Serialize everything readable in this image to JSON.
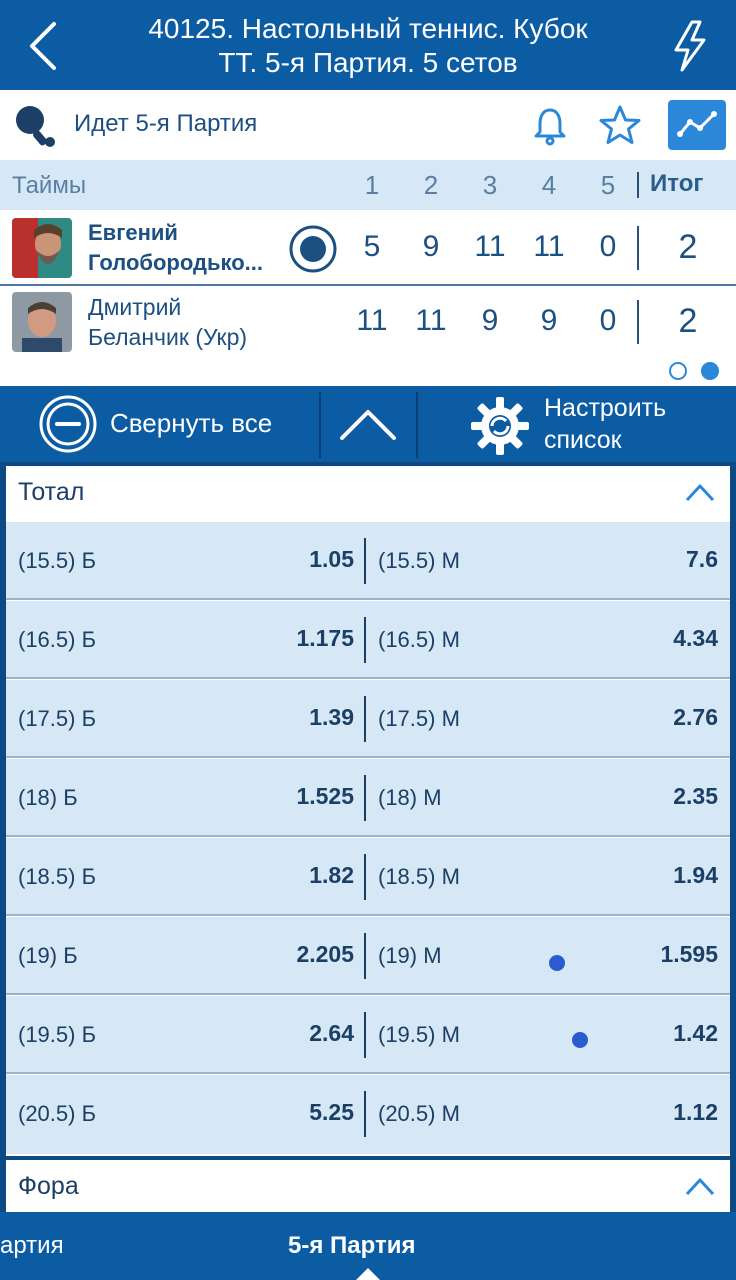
{
  "header": {
    "title": "40125. Настольный теннис. Кубок\nТТ. 5-я  Партия. 5 сетов"
  },
  "status": {
    "label": "Идет 5-я  Партия"
  },
  "scoreboard": {
    "header_label": "Таймы",
    "sets": [
      "1",
      "2",
      "3",
      "4",
      "5"
    ],
    "total_label": "Итог",
    "players": [
      {
        "name": "Евгений\nГолобородько...",
        "scores": [
          "5",
          "9",
          "11",
          "11",
          "0"
        ],
        "total": "2",
        "serving": true
      },
      {
        "name": "Дмитрий\nБеланчик (Укр)",
        "scores": [
          "11",
          "11",
          "9",
          "9",
          "0"
        ],
        "total": "2",
        "serving": false
      }
    ]
  },
  "toolbar": {
    "collapse_label": "Свернуть все",
    "configure_label": "Настроить\nсписок"
  },
  "markets": {
    "total": {
      "title": "Тотал",
      "rows": [
        {
          "over_label": "(15.5) Б",
          "over_odd": "1.05",
          "under_label": "(15.5) М",
          "under_odd": "7.6"
        },
        {
          "over_label": "(16.5) Б",
          "over_odd": "1.175",
          "under_label": "(16.5) М",
          "under_odd": "4.34"
        },
        {
          "over_label": "(17.5) Б",
          "over_odd": "1.39",
          "under_label": "(17.5) М",
          "under_odd": "2.76"
        },
        {
          "over_label": "(18) Б",
          "over_odd": "1.525",
          "under_label": "(18) М",
          "under_odd": "2.35"
        },
        {
          "over_label": "(18.5) Б",
          "over_odd": "1.82",
          "under_label": "(18.5) М",
          "under_odd": "1.94"
        },
        {
          "over_label": "(19) Б",
          "over_odd": "2.205",
          "under_label": "(19) М",
          "under_odd": "1.595"
        },
        {
          "over_label": "(19.5) Б",
          "over_odd": "2.64",
          "under_label": "(19.5) М",
          "under_odd": "1.42"
        },
        {
          "over_label": "(20.5) Б",
          "over_odd": "5.25",
          "under_label": "(20.5) М",
          "under_odd": "1.12"
        }
      ]
    },
    "fora": {
      "title": "Фора"
    }
  },
  "bottom_nav": {
    "left_tab": "артия",
    "active_tab": "5-я  Партия"
  },
  "colors": {
    "primary": "#0c5ca4",
    "light_row": "#d6e7f6",
    "accent": "#2b88d8"
  }
}
